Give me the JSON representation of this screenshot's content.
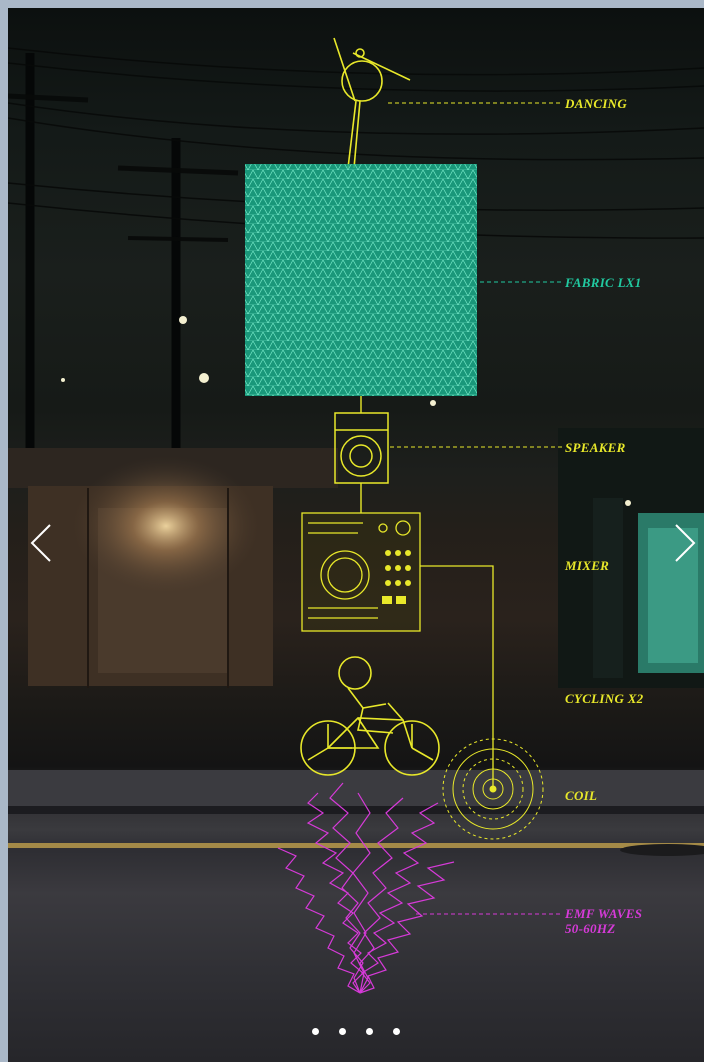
{
  "labels": {
    "dancing": "DANCING",
    "fabric": "FABRIC LX1",
    "speaker": "SPEAKER",
    "mixer": "MIXER",
    "cycling": "CYCLING X2",
    "coil": "COIL",
    "emf_line1": "EMF WAVES",
    "emf_line2": "50-60HZ"
  },
  "colors": {
    "yellow": "#e8e82a",
    "teal": "#21c9a0",
    "magenta": "#d63ad8"
  },
  "navigation": {
    "prev_icon": "chevron-left-icon",
    "next_icon": "chevron-right-icon"
  },
  "pagination": {
    "dot_count": 4
  }
}
